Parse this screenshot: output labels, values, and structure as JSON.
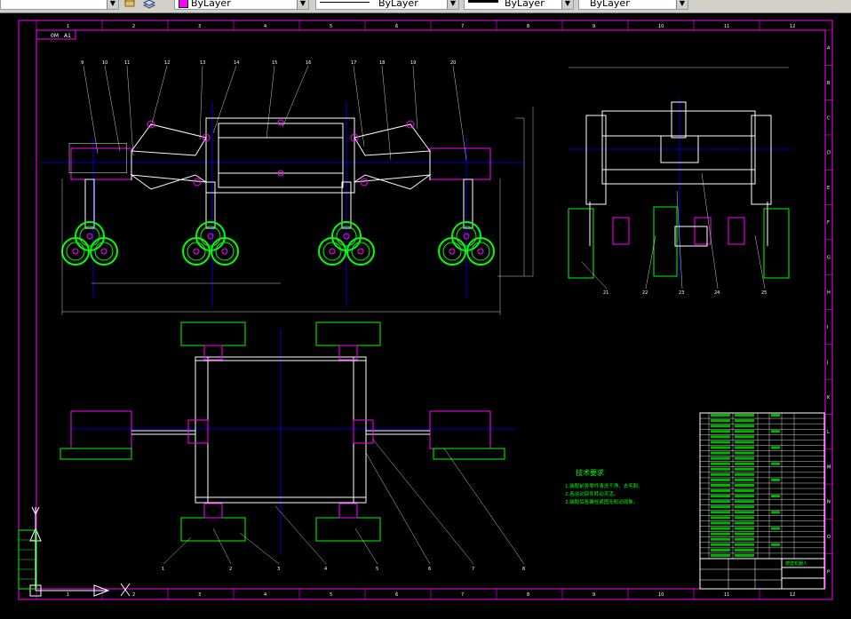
{
  "toolbar": {
    "layer_value": "ByLayer",
    "linetype_value": "ByLayer",
    "lineweight_value": "ByLayer",
    "plotstyle_value": "ByLayer",
    "color_swatch": "#ff00ff"
  },
  "drawing": {
    "view_label": "0M　A1",
    "top_ruler": [
      "1",
      "2",
      "3",
      "4",
      "5",
      "6",
      "7",
      "8",
      "9",
      "10",
      "11",
      "12"
    ],
    "bottom_ruler": [
      "1",
      "2",
      "3",
      "4",
      "5",
      "6",
      "7",
      "8",
      "9",
      "10",
      "11",
      "12"
    ],
    "right_ruler": [
      "A",
      "B",
      "C",
      "D",
      "E",
      "F",
      "G",
      "H",
      "I",
      "J",
      "K",
      "L",
      "M",
      "N",
      "O",
      "P"
    ],
    "front_callouts": [
      "9",
      "10",
      "11",
      "12",
      "13",
      "14",
      "15",
      "16",
      "17",
      "18",
      "19",
      "20"
    ],
    "side_callouts": [
      "21",
      "22",
      "23",
      "24",
      "25"
    ],
    "plan_callouts": [
      "1",
      "2",
      "3",
      "4",
      "5",
      "6",
      "7",
      "8"
    ],
    "notes_title": "技术要求",
    "notes": [
      "1.装配前各零件清洗干净，去毛刺。",
      "2.各运动部件转动灵活。",
      "3.装配后各螺栓紧固无松动现象。"
    ],
    "title_block_name": "爬壁机器人",
    "colors": {
      "green": "#00ff00",
      "white": "#ffffff",
      "magenta": "#ff00ff",
      "blue": "#0000ff",
      "cyan": "#00ffff"
    }
  }
}
